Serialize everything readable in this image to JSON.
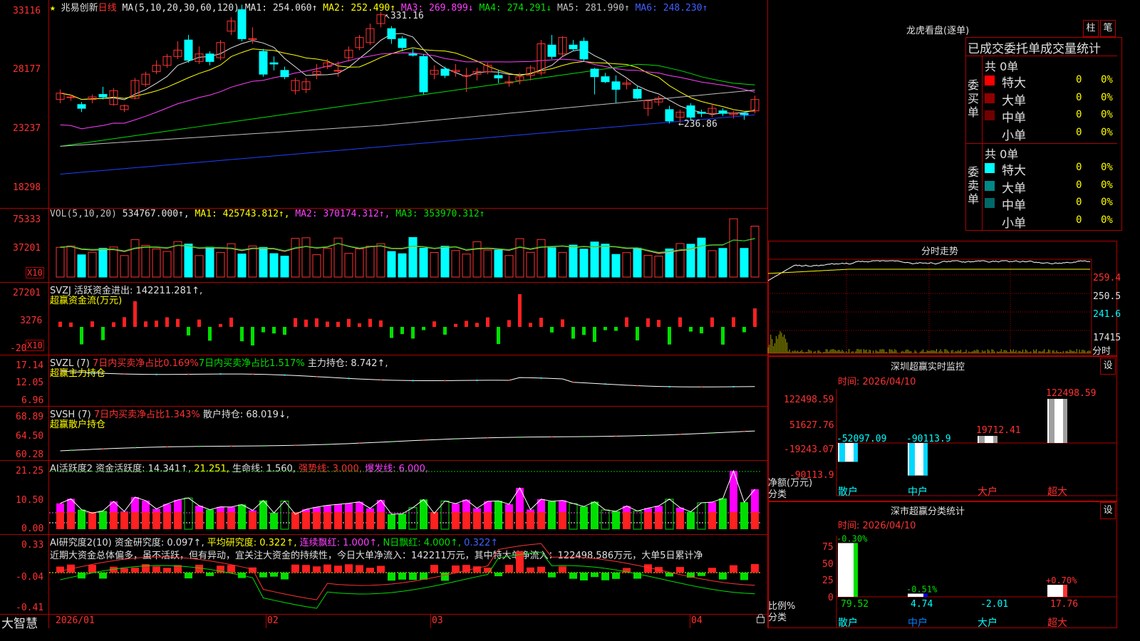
{
  "app": {
    "brand": "大智慧",
    "lock_icon": "lock-icon"
  },
  "header": {
    "star": "★",
    "name": "兆易创新",
    "period": "日线",
    "ma_params": "MA(5,10,20,30,60,120)",
    "ma": [
      {
        "label": "MA1: 254.060↑",
        "color": "#e0e0e0"
      },
      {
        "label": "MA2: 252.490↑",
        "color": "#ffff00"
      },
      {
        "label": "MA3: 269.899↓",
        "color": "#ff40ff"
      },
      {
        "label": "MA4: 274.291↓",
        "color": "#00e000"
      },
      {
        "label": "MA5: 281.990↑",
        "color": "#c0c0c0"
      },
      {
        "label": "MA6: 248.230↑",
        "color": "#4060ff"
      }
    ]
  },
  "price_axis": [
    "33116",
    "28177",
    "23237",
    "18298"
  ],
  "annotations": {
    "high": "331.16",
    "low": "236.86"
  },
  "vol_panel": {
    "title": "VOL(5,10,20)",
    "value": "534767.000↑,",
    "ma1": "MA1: 425743.812↑,",
    "ma2": "MA2: 370174.312↑,",
    "ma3": "MA3: 353970.312↑",
    "axis": [
      "75333",
      "37201"
    ],
    "x10": "X10"
  },
  "svzj_panel": {
    "title": "SVZJ",
    "text": "活跃资金进出: 142211.281↑,",
    "sub": "超赢资金流(万元)",
    "axis": [
      "27201",
      "3276",
      "-20"
    ],
    "x10": "X10"
  },
  "svzl_panel": {
    "title": "SVZL (7)",
    "a": "7日内买卖净占比0.169%",
    "b": "7日内买卖净占比1.517%",
    "c": "主力持仓: 8.742↑,",
    "sub": "超赢主力持仓",
    "axis": [
      "17.14",
      "12.05",
      "6.96"
    ]
  },
  "svsh_panel": {
    "title": "SVSH (7)",
    "a": "7日内买卖净占比1.343%",
    "c": "散户持仓: 68.019↓,",
    "sub": "超赢散户持仓",
    "axis": [
      "68.89",
      "64.50",
      "60.28"
    ]
  },
  "ai_active_panel": {
    "title": "AI活跃度2",
    "a": "资金活跃度: 14.341↑,",
    "b": "21.251,",
    "c": "生命线: 1.560,",
    "d": "强势线: 3.000,",
    "e": "爆发线: 6.000,",
    "axis": [
      "21.25",
      "10.50",
      "0.00"
    ]
  },
  "ai_research_panel": {
    "title": "AI研究度2(10)",
    "a": "资金研究度: 0.097↑,",
    "b": "平均研究度: 0.322↑,",
    "c": "连续飘红: 1.000↑,",
    "d": "N日飘红: 4.000↑,",
    "e": "0.322↑",
    "comment": "近期大资金总体偏多，虽不活跃，但有异动，宜关注大资金的持续性，今日大单净流入：142211万元，其中特大单净流入：122498.586万元，大单5日累计净",
    "axis": [
      "0.33",
      "-0.04",
      "-0.41"
    ]
  },
  "date_axis": [
    "2026/01",
    "02",
    "03",
    "04"
  ],
  "dragon_tiger": {
    "title": "龙虎看盘(逐单)",
    "btn_bar": "柱",
    "btn_pen": "笔",
    "header": "已成交委托单成交量统计",
    "buy": {
      "side": "委买单",
      "total": "共 0单",
      "rows": [
        {
          "name": "特大",
          "count": "0",
          "pct": "0%",
          "color": "#ff0000"
        },
        {
          "name": "大单",
          "count": "0",
          "pct": "0%",
          "color": "#900000"
        },
        {
          "name": "中单",
          "count": "0",
          "pct": "0%",
          "color": "#700000"
        },
        {
          "name": "小单",
          "count": "0",
          "pct": "0%",
          "color": "#000000"
        }
      ]
    },
    "sell": {
      "side": "委卖单",
      "total": "共 0单",
      "rows": [
        {
          "name": "特大",
          "count": "0",
          "pct": "0%",
          "color": "#00ffff"
        },
        {
          "name": "大单",
          "count": "0",
          "pct": "0%",
          "color": "#008888"
        },
        {
          "name": "中单",
          "count": "0",
          "pct": "0%",
          "color": "#006868"
        },
        {
          "name": "小单",
          "count": "0",
          "pct": "0%",
          "color": "#000000"
        }
      ]
    }
  },
  "intraday": {
    "title": "分时走势",
    "axis": [
      "259.4",
      "250.5",
      "241.6",
      "17415"
    ],
    "time_label": "分时"
  },
  "monitor": {
    "title": "深圳超赢实时监控",
    "btn": "设",
    "date": "时间: 2026/04/10",
    "axis": [
      "122498.59",
      "51627.76",
      "-19243.07",
      "-90113.9"
    ],
    "ylabel": "净额(万元)",
    "xlabel": "分类",
    "categories": [
      "散户",
      "中户",
      "大户",
      "超大"
    ],
    "values": [
      -52097.09,
      -90113.9,
      19712.41,
      122498.59
    ],
    "value_labels": [
      "-52097.09",
      "-90113.9",
      "19712.41",
      "122498.59"
    ]
  },
  "classify": {
    "title": "深市超赢分类统计",
    "btn": "设",
    "date": "时间: 2026/04/10",
    "axis": [
      "75",
      "50",
      "25",
      "0"
    ],
    "ylabel": "比例%",
    "xlabel": "分类",
    "categories": [
      "散户",
      "中户",
      "大户",
      "超大"
    ],
    "values": [
      79.52,
      4.74,
      -2.01,
      17.76
    ],
    "value_labels": [
      "79.52",
      "4.74",
      "-2.01",
      "17.76"
    ],
    "change_labels": [
      "-0.30%",
      "-0.51%",
      "",
      "+0.70%"
    ]
  },
  "chart_data": {
    "type": "candlestick",
    "title": "兆易创新 日线",
    "ylim": [
      18298,
      33116
    ],
    "candles": [
      {
        "o": 262,
        "c": 267,
        "h": 270,
        "l": 259
      },
      {
        "o": 264,
        "c": 264,
        "h": 266,
        "l": 261
      },
      {
        "o": 258,
        "c": 255,
        "h": 260,
        "l": 252
      },
      {
        "o": 262,
        "c": 264,
        "h": 266,
        "l": 259
      },
      {
        "o": 266,
        "c": 264,
        "h": 272,
        "l": 262
      },
      {
        "o": 258,
        "c": 269,
        "h": 271,
        "l": 257
      },
      {
        "o": 254,
        "c": 257,
        "h": 258,
        "l": 252
      },
      {
        "o": 263,
        "c": 277,
        "h": 279,
        "l": 262
      },
      {
        "o": 274,
        "c": 282,
        "h": 284,
        "l": 272
      },
      {
        "o": 284,
        "c": 289,
        "h": 293,
        "l": 282
      },
      {
        "o": 289,
        "c": 296,
        "h": 298,
        "l": 287
      },
      {
        "o": 296,
        "c": 301,
        "h": 308,
        "l": 294
      },
      {
        "o": 309,
        "c": 293,
        "h": 313,
        "l": 291
      },
      {
        "o": 292,
        "c": 298,
        "h": 304,
        "l": 290
      },
      {
        "o": 298,
        "c": 292,
        "h": 300,
        "l": 289
      },
      {
        "o": 295,
        "c": 307,
        "h": 309,
        "l": 293
      },
      {
        "o": 316,
        "c": 324,
        "h": 327,
        "l": 313
      },
      {
        "o": 333,
        "c": 310,
        "h": 337,
        "l": 308
      },
      {
        "o": 310,
        "c": 310,
        "h": 319,
        "l": 306
      },
      {
        "o": 300,
        "c": 282,
        "h": 302,
        "l": 280
      },
      {
        "o": 291,
        "c": 290,
        "h": 296,
        "l": 285
      },
      {
        "o": 285,
        "c": 280,
        "h": 288,
        "l": 278
      },
      {
        "o": 269,
        "c": 277,
        "h": 279,
        "l": 266
      },
      {
        "o": 270,
        "c": 276,
        "h": 279,
        "l": 267
      },
      {
        "o": 282,
        "c": 284,
        "h": 290,
        "l": 278
      },
      {
        "o": 288,
        "c": 291,
        "h": 294,
        "l": 286
      },
      {
        "o": 285,
        "c": 285,
        "h": 292,
        "l": 280
      },
      {
        "o": 295,
        "c": 301,
        "h": 304,
        "l": 292
      },
      {
        "o": 303,
        "c": 311,
        "h": 313,
        "l": 301
      },
      {
        "o": 307,
        "c": 318,
        "h": 322,
        "l": 305
      },
      {
        "o": 322,
        "c": 329,
        "h": 331,
        "l": 319
      },
      {
        "o": 318,
        "c": 310,
        "h": 320,
        "l": 306
      },
      {
        "o": 310,
        "c": 303,
        "h": 312,
        "l": 300
      },
      {
        "o": 298,
        "c": 297,
        "h": 302,
        "l": 296
      },
      {
        "o": 296,
        "c": 268,
        "h": 298,
        "l": 266
      },
      {
        "o": 282,
        "c": 285,
        "h": 289,
        "l": 278
      },
      {
        "o": 286,
        "c": 281,
        "h": 288,
        "l": 279
      },
      {
        "o": 284,
        "c": 285,
        "h": 290,
        "l": 280
      },
      {
        "o": 281,
        "c": 281,
        "h": 287,
        "l": 268
      },
      {
        "o": 282,
        "c": 284,
        "h": 287,
        "l": 277
      },
      {
        "o": 284,
        "c": 289,
        "h": 291,
        "l": 282
      },
      {
        "o": 281,
        "c": 279,
        "h": 285,
        "l": 275
      },
      {
        "o": 275,
        "c": 276,
        "h": 281,
        "l": 272
      },
      {
        "o": 277,
        "c": 280,
        "h": 283,
        "l": 274
      },
      {
        "o": 281,
        "c": 287,
        "h": 289,
        "l": 277
      },
      {
        "o": 283,
        "c": 306,
        "h": 309,
        "l": 281
      },
      {
        "o": 305,
        "c": 296,
        "h": 313,
        "l": 294
      },
      {
        "o": 298,
        "c": 311,
        "h": 312,
        "l": 296
      },
      {
        "o": 305,
        "c": 302,
        "h": 309,
        "l": 300
      },
      {
        "o": 308,
        "c": 294,
        "h": 311,
        "l": 292
      },
      {
        "o": 286,
        "c": 280,
        "h": 287,
        "l": 266
      },
      {
        "o": 280,
        "c": 276,
        "h": 283,
        "l": 275
      },
      {
        "o": 276,
        "c": 270,
        "h": 281,
        "l": 259
      },
      {
        "o": 274,
        "c": 275,
        "h": 278,
        "l": 270
      },
      {
        "o": 270,
        "c": 263,
        "h": 273,
        "l": 262
      },
      {
        "o": 255,
        "c": 261,
        "h": 262,
        "l": 249
      },
      {
        "o": 260,
        "c": 263,
        "h": 265,
        "l": 257
      },
      {
        "o": 254,
        "c": 245,
        "h": 257,
        "l": 243
      },
      {
        "o": 248,
        "c": 252,
        "h": 254,
        "l": 244
      },
      {
        "o": 257,
        "c": 248,
        "h": 259,
        "l": 246
      },
      {
        "o": 252,
        "c": 251,
        "h": 254,
        "l": 248
      },
      {
        "o": 251,
        "c": 255,
        "h": 259,
        "l": 248
      },
      {
        "o": 253,
        "c": 251,
        "h": 255,
        "l": 249
      },
      {
        "o": 250,
        "c": 251,
        "h": 253,
        "l": 247
      },
      {
        "o": 251,
        "c": 250,
        "h": 252,
        "l": 246
      },
      {
        "o": 253,
        "c": 262,
        "h": 265,
        "l": 251
      }
    ]
  }
}
